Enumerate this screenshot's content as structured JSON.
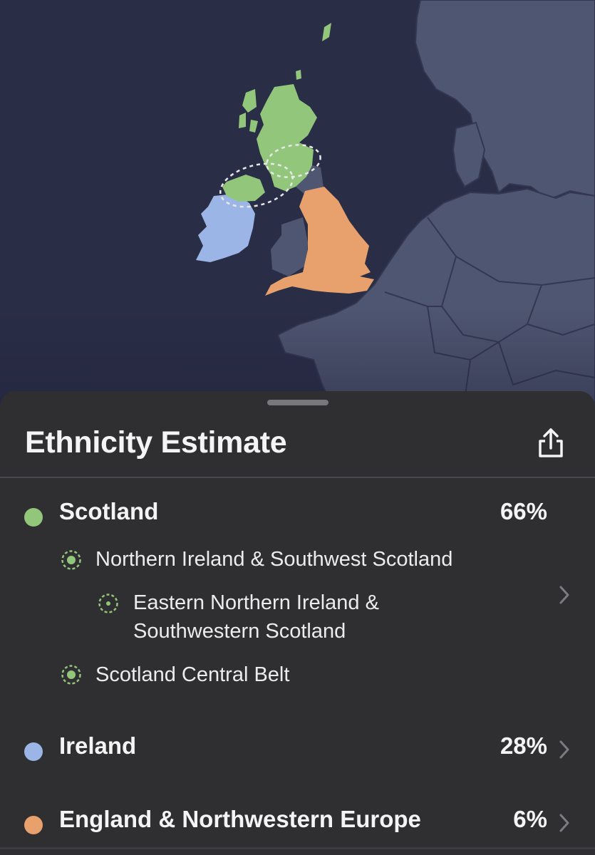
{
  "sheet": {
    "title": "Ethnicity Estimate",
    "share_icon": "share-icon"
  },
  "colors": {
    "scotland": "#92c77b",
    "ireland": "#9bb6e6",
    "england": "#e8a06c",
    "ocean": "#2a2d46",
    "land": "#4f5671"
  },
  "regions": [
    {
      "name": "Scotland",
      "percent": "66%",
      "subregions": [
        {
          "name": "Northern Ireland & Southwest Scotland",
          "level": 1
        },
        {
          "name": "Eastern Northern Ireland &",
          "name2": "Southwestern Scotland",
          "level": 2
        },
        {
          "name": "Scotland Central Belt",
          "level": 1
        }
      ]
    },
    {
      "name": "Ireland",
      "percent": "28%"
    },
    {
      "name": "England & Northwestern Europe",
      "percent": "6%"
    }
  ]
}
